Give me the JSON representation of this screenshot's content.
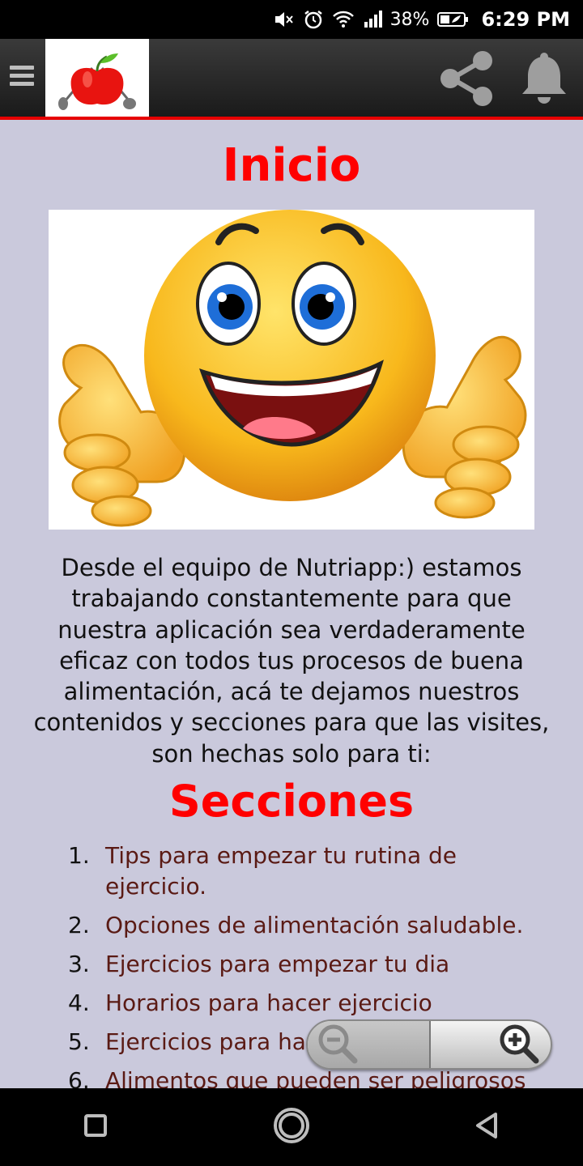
{
  "status_bar": {
    "battery_percent": "38%",
    "time": "6:29 PM",
    "icons": [
      "mute-icon",
      "alarm-icon",
      "wifi-icon",
      "signal-icon",
      "battery-saver-icon"
    ]
  },
  "app_bar": {
    "menu_icon": "hamburger-menu-icon",
    "logo": "apple-logo-icon",
    "share_icon": "share-icon",
    "bell_icon": "bell-icon",
    "accent_color": "#e60000"
  },
  "content": {
    "title": "Inicio",
    "intro": "Desde el equipo de Nutriapp:) estamos trabajando constantemente para que nuestra aplicación sea verdaderamente eficaz con todos tus procesos de buena alimentación, acá te dejamos nuestros contenidos y secciones para que las visites, son hechas solo para ti:",
    "sections_title": "Secciones",
    "sections": [
      {
        "num": "1.",
        "label": "Tips para empezar tu rutina de ejercicio."
      },
      {
        "num": "2.",
        "label": "Opciones de alimentación saludable."
      },
      {
        "num": "3.",
        "label": "Ejercicios para empezar tu dia"
      },
      {
        "num": "4.",
        "label": "Horarios para hacer ejercicio"
      },
      {
        "num": "5.",
        "label": "Ejercicios para ha"
      },
      {
        "num": "6.",
        "label": "Alimentos que pueden ser peligrosos"
      }
    ],
    "title_color": "#ff0000",
    "link_color": "#5a1a14"
  },
  "zoom": {
    "zoom_out_icon": "zoom-out-icon",
    "zoom_in_icon": "zoom-in-icon"
  },
  "nav_bar": {
    "icons": [
      "recents-square-icon",
      "home-circle-icon",
      "back-triangle-icon"
    ]
  }
}
